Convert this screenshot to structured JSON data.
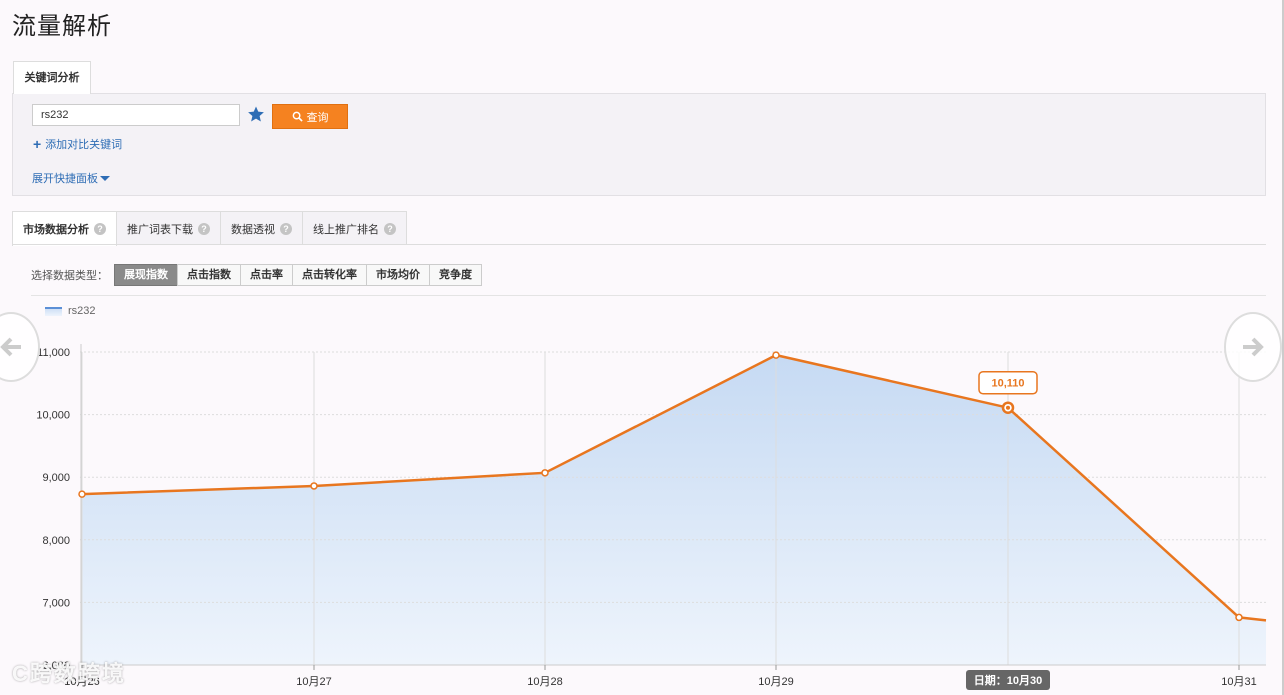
{
  "page": {
    "title": "流量解析"
  },
  "top_tab": {
    "label": "关键词分析"
  },
  "search": {
    "keyword_value": "rs232",
    "query_label": "查询",
    "add_compare_label": "添加对比关键词",
    "expand_panel_label": "展开快捷面板"
  },
  "tabs": [
    {
      "label": "市场数据分析",
      "active": true
    },
    {
      "label": "推广词表下载",
      "active": false
    },
    {
      "label": "数据透视",
      "active": false
    },
    {
      "label": "线上推广排名",
      "active": false
    }
  ],
  "data_type": {
    "label": "选择数据类型：",
    "options": [
      {
        "label": "展现指数",
        "active": true
      },
      {
        "label": "点击指数",
        "active": false
      },
      {
        "label": "点击率",
        "active": false
      },
      {
        "label": "点击转化率",
        "active": false
      },
      {
        "label": "市场均价",
        "active": false
      },
      {
        "label": "竞争度",
        "active": false
      }
    ]
  },
  "colors": {
    "accent": "#f58220",
    "line": "#e8761f",
    "area": "#cfe0f5",
    "link": "#2e6db5"
  },
  "chart_data": {
    "type": "area",
    "x": [
      "10月26",
      "10月27",
      "10月28",
      "10月29",
      "10月30",
      "10月31"
    ],
    "series": [
      {
        "name": "rs232",
        "values": [
          8730,
          8860,
          9070,
          10950,
          10110,
          6760
        ]
      }
    ],
    "y_ticks": [
      "11,000",
      "10,000",
      "9,000",
      "8,000",
      "7,000",
      "6,000"
    ],
    "ylim": [
      6000,
      11000
    ],
    "tooltip": {
      "value": "10,110",
      "date_label": "日期：10月30"
    },
    "grid": true,
    "legend": "top-left"
  },
  "watermark": {
    "text": "C跨数跨境"
  }
}
